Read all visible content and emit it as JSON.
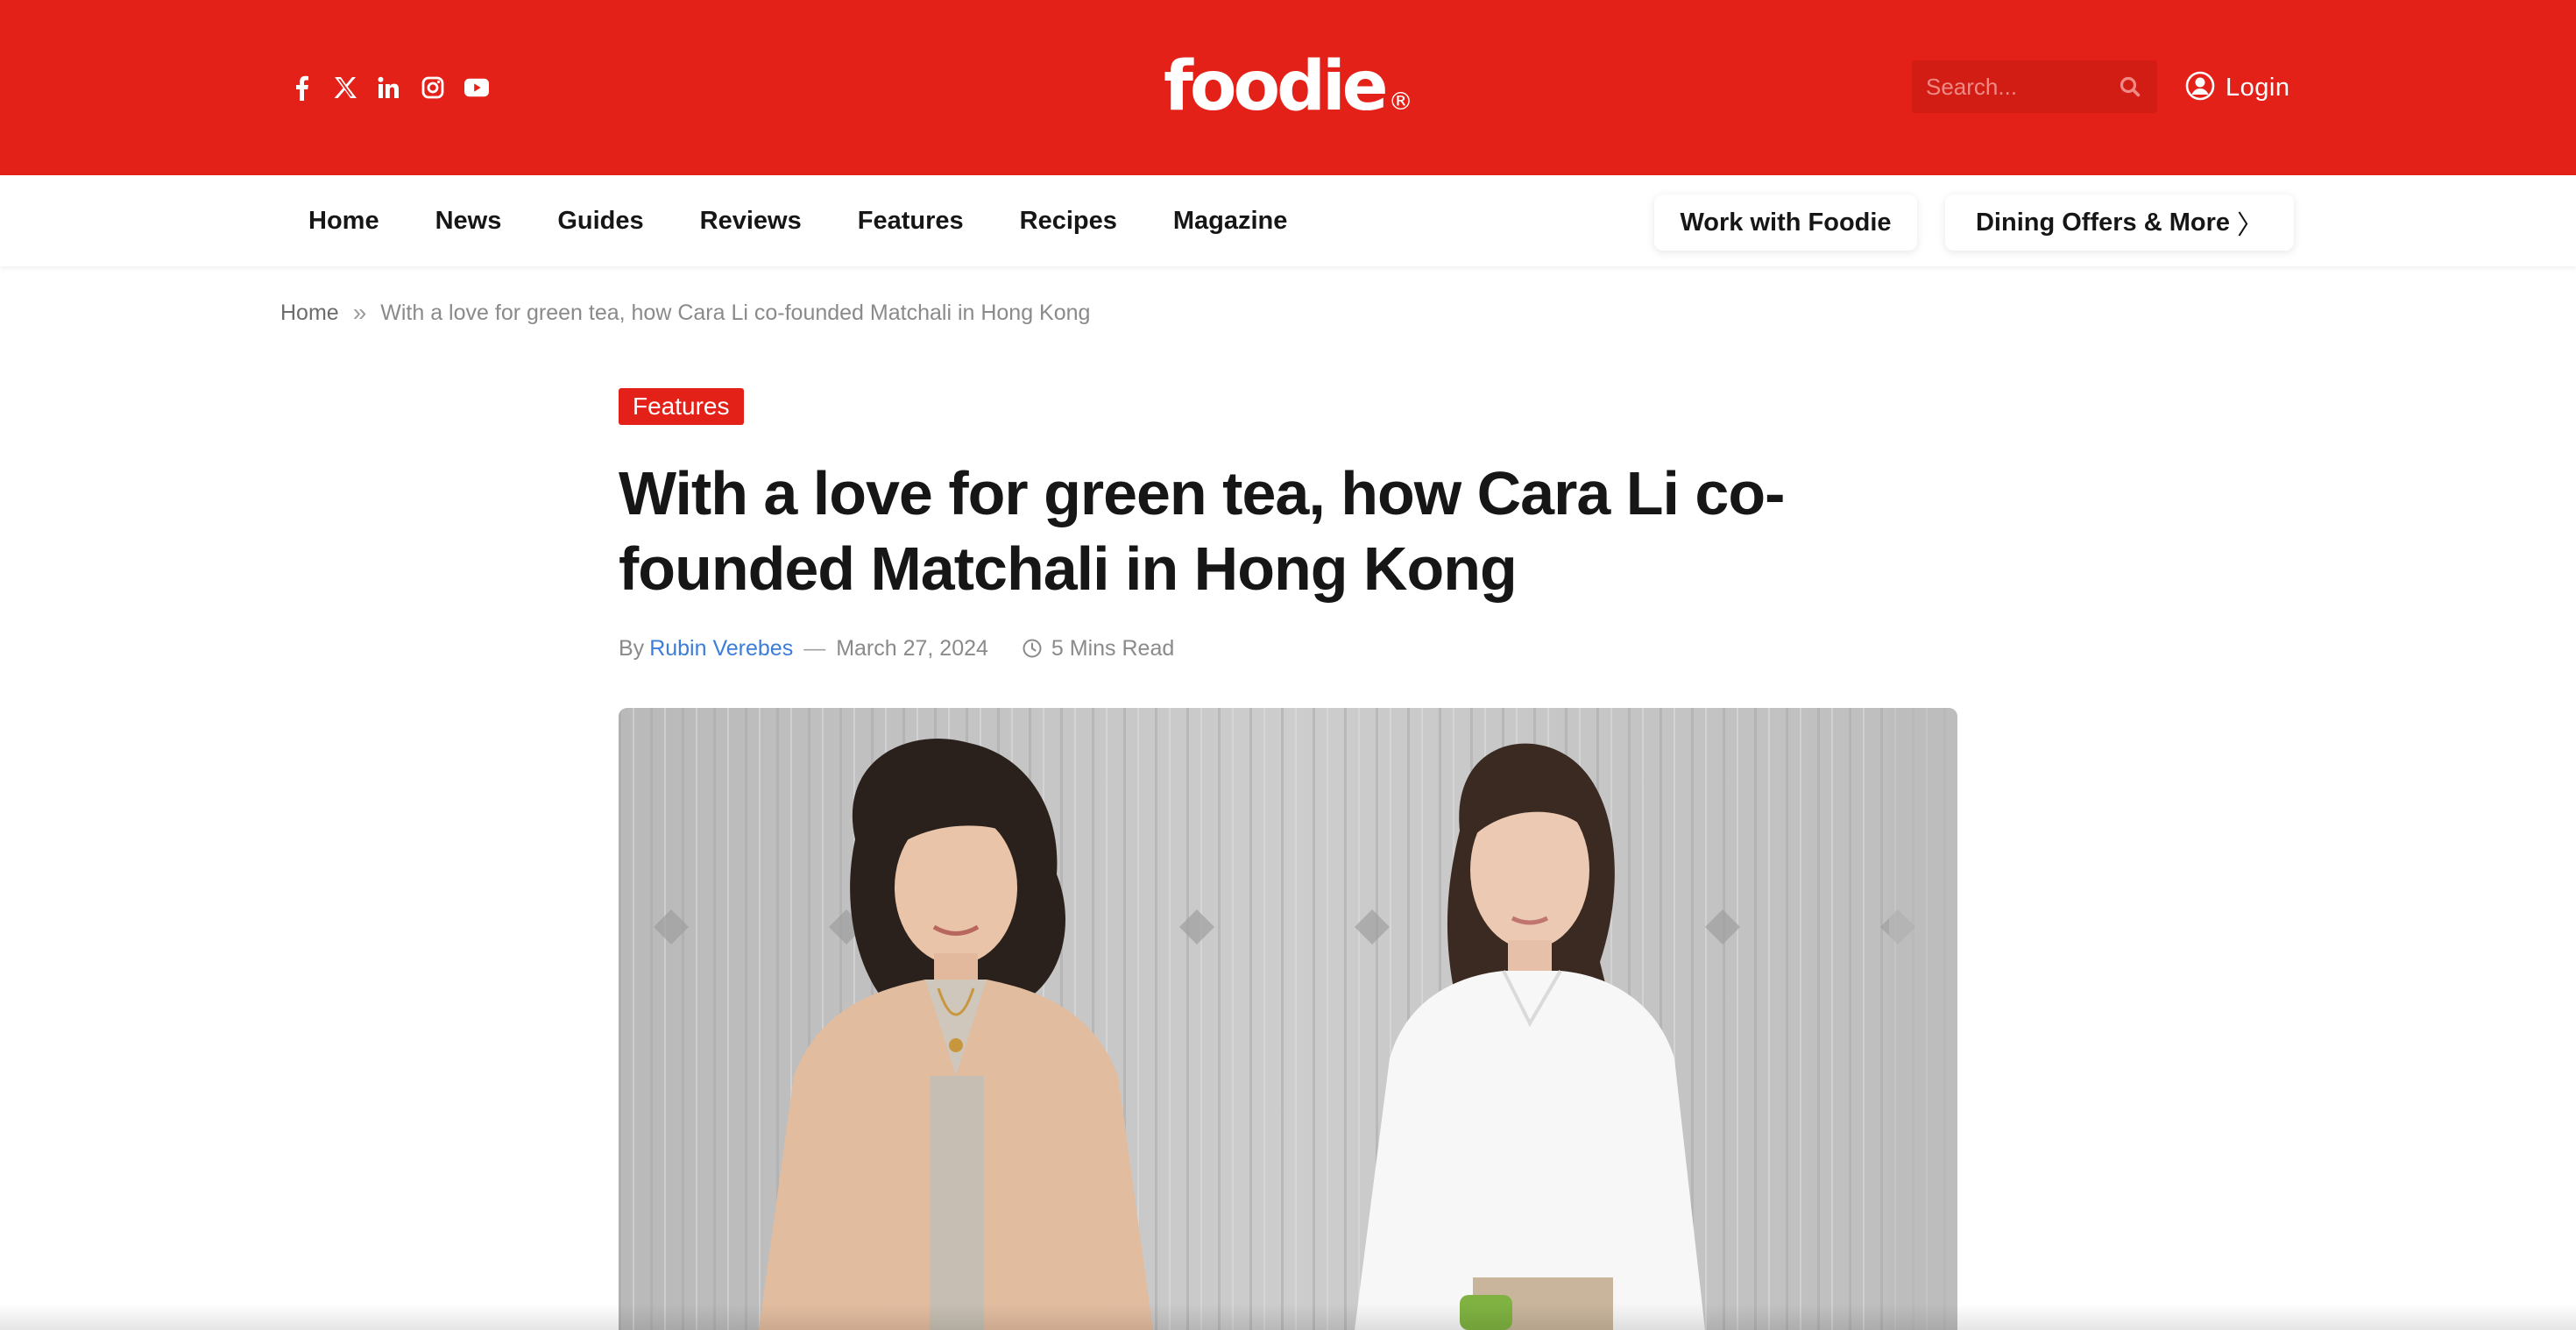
{
  "header": {
    "brand_color": "#e32119",
    "socials": [
      {
        "name": "facebook-icon"
      },
      {
        "name": "x-icon"
      },
      {
        "name": "linkedin-icon"
      },
      {
        "name": "instagram-icon"
      },
      {
        "name": "youtube-icon"
      }
    ],
    "logo_text": "foodie",
    "logo_mark": "®",
    "search_placeholder": "Search...",
    "search_icon": "search-icon",
    "login_icon": "user-circle-icon",
    "login_label": "Login"
  },
  "nav": {
    "items": [
      "Home",
      "News",
      "Guides",
      "Reviews",
      "Features",
      "Recipes",
      "Magazine"
    ],
    "work_label": "Work with Foodie",
    "dining_label": "Dining Offers & More",
    "dining_chevron": "〉"
  },
  "breadcrumb": {
    "home": "Home",
    "separator": "»",
    "current": "With a love for green tea, how Cara Li co-founded Matchali in Hong Kong"
  },
  "article": {
    "category": "Features",
    "title": "With a love for green tea, how Cara Li co-founded Matchali in Hong Kong",
    "by_label": "By",
    "author": "Rubin Verebes",
    "meta_dash": "—",
    "date": "March 27, 2024",
    "read_time": "5 Mins Read",
    "author_color": "#3b7dd8"
  }
}
